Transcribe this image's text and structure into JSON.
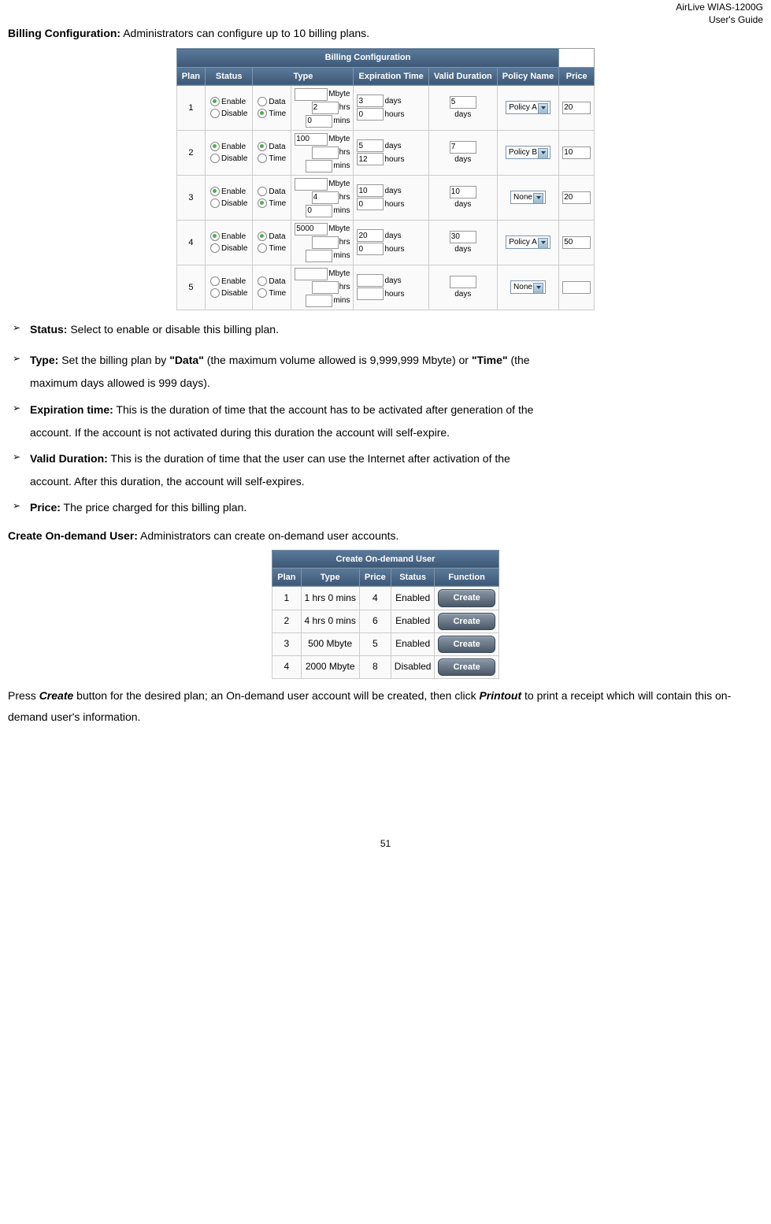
{
  "header": {
    "line1": "AirLive WIAS-1200G",
    "line2": "User's Guide"
  },
  "billing": {
    "title": "Billing Configuration:",
    "desc": " Administrators can configure up to 10 billing plans.",
    "tableTitle": "Billing Configuration",
    "headers": {
      "plan": "Plan",
      "status": "Status",
      "type": "Type",
      "exp": "Expiration Time",
      "valid": "Valid Duration",
      "policy": "Policy Name",
      "price": "Price"
    },
    "labels": {
      "enable": "Enable",
      "disable": "Disable",
      "data": "Data",
      "time": "Time",
      "mbyte": "Mbyte",
      "hrs": "hrs",
      "mins": "mins",
      "days": "days",
      "hours": "hours"
    },
    "rows": [
      {
        "plan": "1",
        "statusSel": "enable",
        "typeSel": "time",
        "mbyte": "",
        "hrs": "2",
        "mins": "0",
        "expDays": "3",
        "expHours": "0",
        "validDays": "5",
        "policy": "Policy A",
        "price": "20"
      },
      {
        "plan": "2",
        "statusSel": "enable",
        "typeSel": "data",
        "mbyte": "100",
        "hrs": "",
        "mins": "",
        "expDays": "5",
        "expHours": "12",
        "validDays": "7",
        "policy": "Policy B",
        "price": "10"
      },
      {
        "plan": "3",
        "statusSel": "enable",
        "typeSel": "time",
        "mbyte": "",
        "hrs": "4",
        "mins": "0",
        "expDays": "10",
        "expHours": "0",
        "validDays": "10",
        "policy": "None",
        "price": "20"
      },
      {
        "plan": "4",
        "statusSel": "enable",
        "typeSel": "data",
        "mbyte": "5000",
        "hrs": "",
        "mins": "",
        "expDays": "20",
        "expHours": "0",
        "validDays": "30",
        "policy": "Policy A",
        "price": "50"
      },
      {
        "plan": "5",
        "statusSel": "none",
        "typeSel": "none",
        "mbyte": "",
        "hrs": "",
        "mins": "",
        "expDays": "",
        "expHours": "",
        "validDays": "",
        "policy": "None",
        "price": ""
      }
    ]
  },
  "bullets": {
    "status": {
      "label": "Status:",
      "text": " Select to enable or disable this billing plan."
    },
    "type": {
      "label": "Type:",
      "t1": " Set the billing plan by ",
      "b1": "\"Data\"",
      "t2": " (the maximum volume allowed is 9,999,999 Mbyte) or ",
      "b2": "\"Time\"",
      "t3": " (the",
      "cont": "maximum days allowed is 999 days)."
    },
    "exp": {
      "label": "Expiration time:",
      "text": " This is the duration of time that the account has to be activated after generation of the",
      "cont": "account. If the account is not activated during this duration the account will self-expire."
    },
    "valid": {
      "label": "Valid Duration:",
      "text": " This is the duration of time that the user can use the Internet after activation of the",
      "cont": "account. After this duration, the account will self-expires."
    },
    "price": {
      "label": "Price:",
      "text": " The price charged for this billing plan."
    }
  },
  "createUser": {
    "title": "Create On-demand User:",
    "desc": " Administrators can create on-demand user accounts.",
    "tableTitle": "Create On-demand User",
    "headers": {
      "plan": "Plan",
      "type": "Type",
      "price": "Price",
      "status": "Status",
      "function": "Function"
    },
    "btnLabel": "Create",
    "rows": [
      {
        "plan": "1",
        "type": "1 hrs 0 mins",
        "price": "4",
        "status": "Enabled"
      },
      {
        "plan": "2",
        "type": "4 hrs 0 mins",
        "price": "6",
        "status": "Enabled"
      },
      {
        "plan": "3",
        "type": "500 Mbyte",
        "price": "5",
        "status": "Enabled"
      },
      {
        "plan": "4",
        "type": "2000 Mbyte",
        "price": "8",
        "status": "Disabled"
      }
    ]
  },
  "footer": {
    "t1": "Press ",
    "b1": "Create",
    "t2": " button for the desired plan; an On-demand user account will be created, then click ",
    "b2": "Printout",
    "t3": "to print a receipt which will contain this on-demand user's information."
  },
  "pageNumber": "51"
}
